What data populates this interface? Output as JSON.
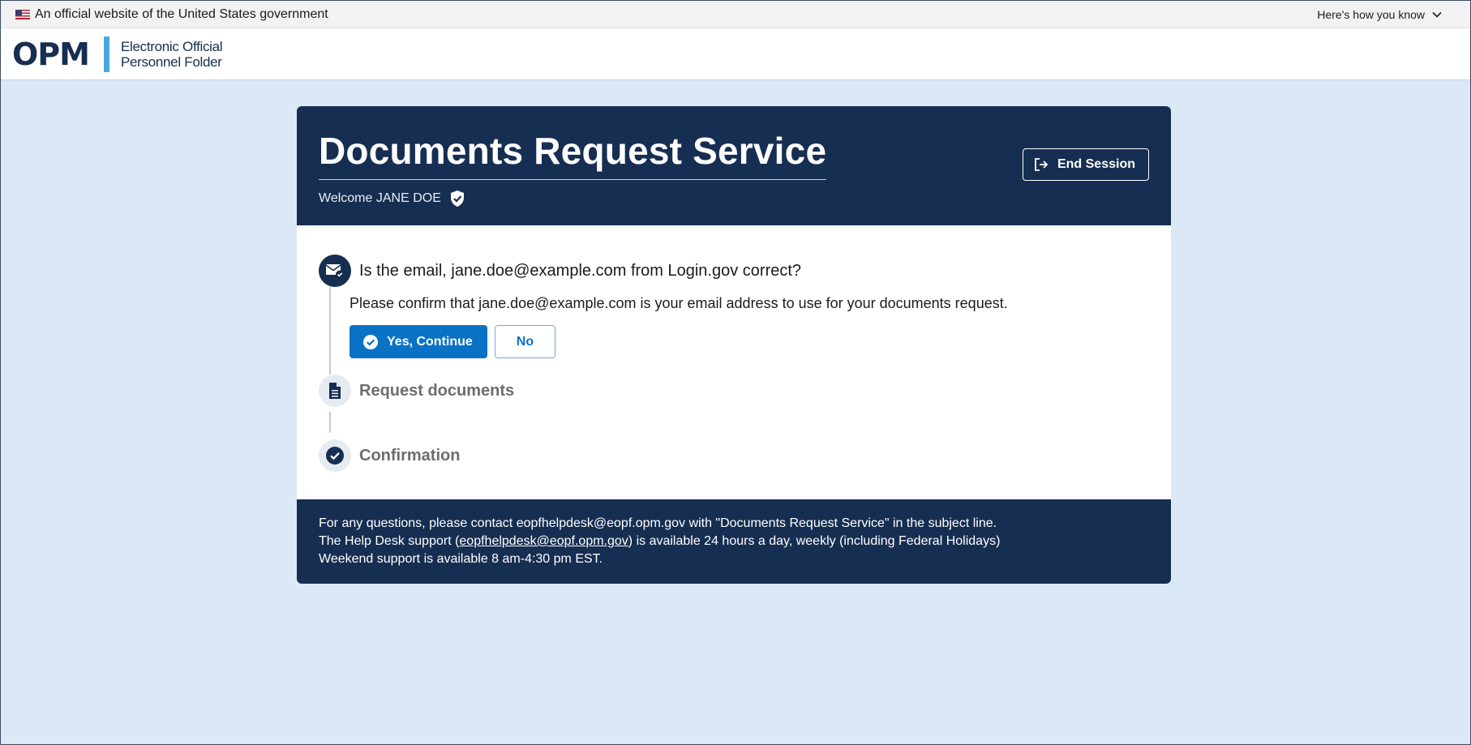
{
  "gov_banner": {
    "text": "An official website of the United States government",
    "how_you_know": "Here's how you know"
  },
  "header": {
    "logo_text": "OPM",
    "brand_line1": "Electronic Official",
    "brand_line2": "Personnel Folder"
  },
  "card": {
    "title": "Documents Request Service",
    "welcome_prefix": "Welcome",
    "user_name": "JANE DOE",
    "end_session_label": "End Session"
  },
  "steps": [
    {
      "title_prefix": "Is the email,",
      "email": "jane.doe@example.com",
      "title_suffix": "from Login.gov correct?",
      "confirm_prefix": "Please confirm that",
      "confirm_email": "jane.doe@example.com",
      "confirm_suffix": "is your email address to use for your documents request.",
      "yes_label": "Yes, Continue",
      "no_label": "No",
      "icon": "envelope-check-icon"
    },
    {
      "title": "Request documents",
      "icon": "document-icon"
    },
    {
      "title": "Confirmation",
      "icon": "check-circle-icon"
    }
  ],
  "footer": {
    "line1": "For any questions, please contact eopfhelpdesk@eopf.opm.gov with \"Documents Request Service\" in the subject line.",
    "line2_prefix": "The Help Desk support (",
    "line2_link": "eopfhelpdesk@eopf.opm.gov",
    "line2_suffix": ") is available 24 hours a day, weekly (including Federal Holidays)",
    "line3": "Weekend support is available 8 am-4:30 pm EST."
  },
  "colors": {
    "navy": "#162e51",
    "primary_blue": "#0a72c4",
    "page_bg": "#dbe8f6",
    "logo_bar": "#4aa8de"
  }
}
